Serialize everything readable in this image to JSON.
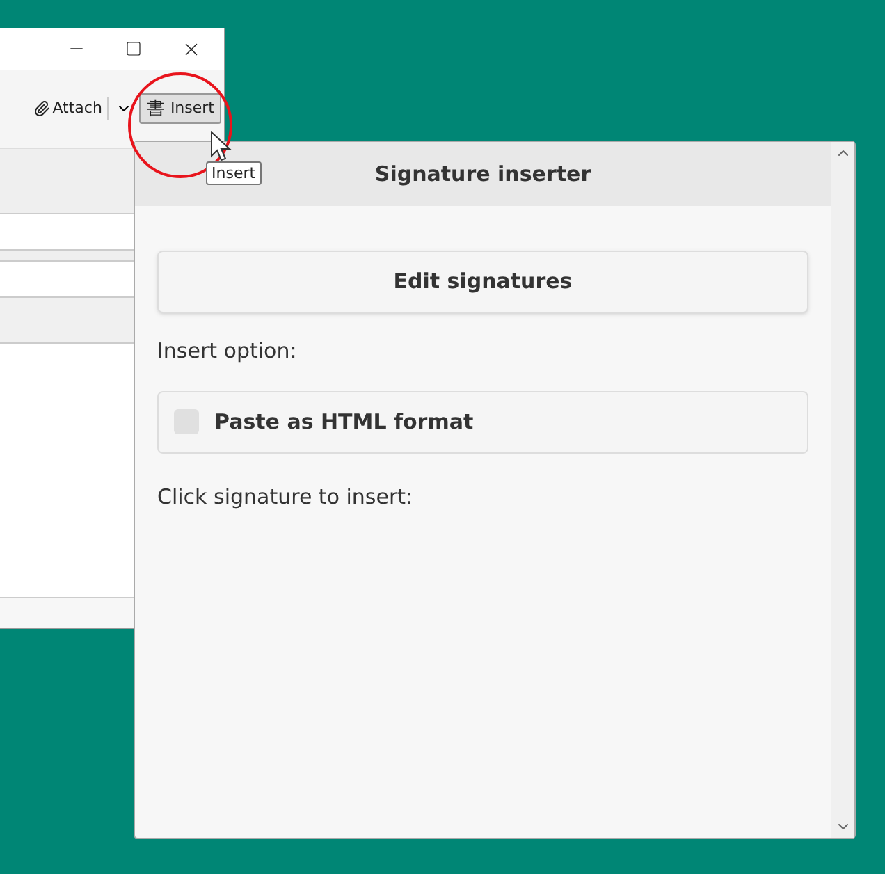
{
  "back_window": {
    "toolbar": [
      {
        "kind": "attach",
        "label": "Attach"
      },
      {
        "kind": "dropdown"
      },
      {
        "kind": "insert",
        "glyph": "書",
        "label": "Insert"
      }
    ],
    "tooltip": "Insert"
  },
  "panel": {
    "title": "Signature inserter",
    "edit_button": "Edit signatures",
    "insert_option_label": "Insert option:",
    "paste_html": {
      "label": "Paste as HTML format",
      "checked": false
    },
    "click_hint": "Click signature to insert:"
  }
}
